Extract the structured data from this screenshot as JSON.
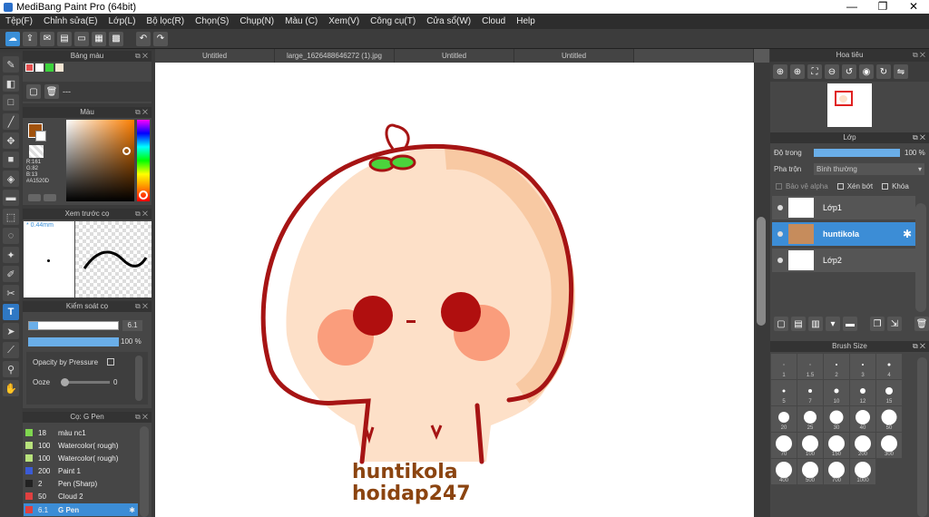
{
  "window": {
    "title": "MediBang Paint Pro (64bit)",
    "minimize": "—",
    "restore": "❐",
    "close": "✕"
  },
  "menu": [
    "Tệp(F)",
    "Chỉnh sửa(E)",
    "Lớp(L)",
    "Bộ lọc(R)",
    "Chọn(S)",
    "Chụp(N)",
    "Màu (C)",
    "Xem(V)",
    "Công cụ(T)",
    "Cửa sổ(W)",
    "Cloud",
    "Help"
  ],
  "toolbar_icons": [
    "cloud-icon",
    "share-icon",
    "comment-icon",
    "document-icon",
    "page-icon",
    "grid-icon",
    "layout-icon",
    "undo-icon",
    "redo-icon"
  ],
  "tabs": [
    {
      "label": "Untitled"
    },
    {
      "label": "large_1626488646272 (1).jpg"
    },
    {
      "label": "Untitled"
    },
    {
      "label": "Untitled"
    }
  ],
  "palette_panel": {
    "title": "Bảng màu",
    "value": "---",
    "swatches": [
      "#e65050",
      "#ffffff",
      "#3cd33c",
      "#f5e6d3"
    ]
  },
  "color_panel": {
    "title": "Màu",
    "r": "R:161",
    "g": "G:82",
    "b": "B:13",
    "hex": "#A1520D",
    "main_color": "#A1520D"
  },
  "preview_panel": {
    "title": "Xem trước cọ",
    "size": "0.44mm"
  },
  "brush_control": {
    "title": "Kiểm soát cọ",
    "size_value": "6.1",
    "opacity_value": "100 %",
    "opacity_pressure": "Opacity by Pressure",
    "ooze_label": "Ooze",
    "ooze_value": "0"
  },
  "brush_list": {
    "title": "Cọ: G Pen",
    "items": [
      {
        "size": "18",
        "name": "màu nc1",
        "color": "#7fd64f"
      },
      {
        "size": "100",
        "name": "Watercolor( rough)",
        "color": "#b8e27c"
      },
      {
        "size": "100",
        "name": "Watercolor( rough)",
        "color": "#b8e27c"
      },
      {
        "size": "200",
        "name": "Paint 1",
        "color": "#3b5bd6"
      },
      {
        "size": "2",
        "name": "Pen (Sharp)",
        "color": "#222222"
      },
      {
        "size": "50",
        "name": "Cloud 2",
        "color": "#e04040"
      },
      {
        "size": "6.1",
        "name": "G Pen",
        "color": "#e04040"
      }
    ]
  },
  "navigator": {
    "title": "Hoa tiêu"
  },
  "layer_panel": {
    "title": "Lớp",
    "opacity_label": "Độ trong",
    "opacity_value": "100 %",
    "blend_label": "Pha trộn",
    "blend_value": "Bình thường",
    "protect_alpha": "Bảo vệ alpha",
    "clipping": "Xén bớt",
    "lock": "Khóa",
    "layers": [
      "Lớp1",
      "huntikola",
      "Lớp2"
    ]
  },
  "brush_size": {
    "title": "Brush Size",
    "sizes": [
      "1",
      "1.5",
      "2",
      "3",
      "4",
      "5",
      "7",
      "10",
      "12",
      "15",
      "20",
      "25",
      "30",
      "40",
      "50",
      "70",
      "100",
      "150",
      "200",
      "300",
      "400",
      "500",
      "700",
      "1000"
    ]
  },
  "artwork": {
    "text_line1": "huntikola",
    "text_line2": "hoidap247"
  }
}
